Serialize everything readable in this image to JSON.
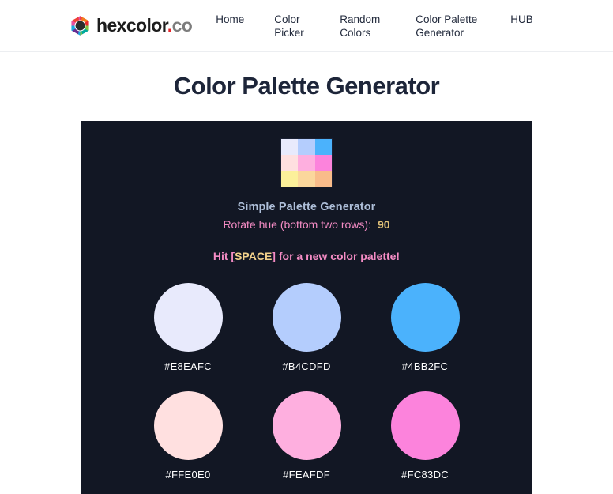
{
  "header": {
    "logo": {
      "icon": "hexagon-color-wheel-icon",
      "name_main": "hexcolor",
      "name_dot": ".",
      "name_tld": "co",
      "dot_color": "#e8262b"
    },
    "nav": [
      {
        "label": "Home"
      },
      {
        "label": "Color Picker"
      },
      {
        "label": "Random Colors"
      },
      {
        "label": "Color Palette Generator"
      },
      {
        "label": "HUB"
      }
    ]
  },
  "page": {
    "title": "Color Palette Generator"
  },
  "panel": {
    "background": "#121724",
    "preview": {
      "name": "palette-preview-grid",
      "cells": [
        "#E8EAFC",
        "#B4CDFD",
        "#4BB2FC",
        "#FFE0E0",
        "#FEAFDF",
        "#FC83DC",
        "#FCF09A",
        "#FBD79C",
        "#F9BC8A"
      ]
    },
    "subtitle": "Simple Palette Generator",
    "rotate": {
      "label": "Rotate hue (bottom two rows):",
      "value": "90",
      "label_color": "#f58cc5",
      "value_color": "#e0c178"
    },
    "hint": {
      "prefix": "Hit [",
      "key": "SPACE",
      "suffix": "] for a new color palette!",
      "text_color": "#f58cc5",
      "key_color": "#f2d08a"
    },
    "swatches": [
      [
        {
          "hex": "#E8EAFC",
          "label": "#E8EAFC"
        },
        {
          "hex": "#B4CDFD",
          "label": "#B4CDFD"
        },
        {
          "hex": "#4BB2FC",
          "label": "#4BB2FC"
        }
      ],
      [
        {
          "hex": "#FFE0E0",
          "label": "#FFE0E0"
        },
        {
          "hex": "#FEAFDF",
          "label": "#FEAFDF"
        },
        {
          "hex": "#FC83DC",
          "label": "#FC83DC"
        }
      ]
    ]
  }
}
